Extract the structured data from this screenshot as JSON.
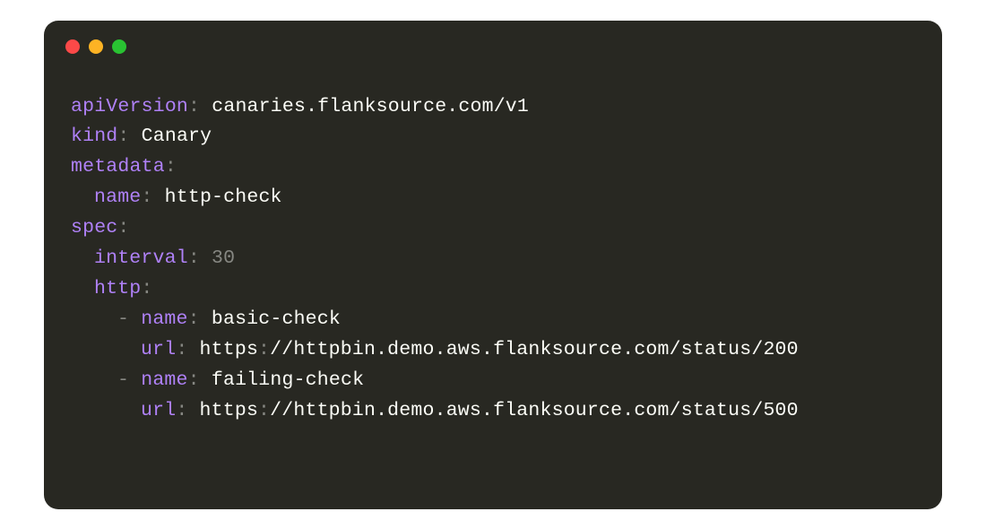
{
  "code": {
    "apiVersion_key": "apiVersion",
    "apiVersion_val": "canaries.flanksource.com/v1",
    "kind_key": "kind",
    "kind_val": "Canary",
    "metadata_key": "metadata",
    "meta_name_key": "name",
    "meta_name_val": "http-check",
    "spec_key": "spec",
    "interval_key": "interval",
    "interval_val": "30",
    "http_key": "http",
    "item1_name_key": "name",
    "item1_name_val": "basic-check",
    "item1_url_key": "url",
    "item1_url_scheme": "https",
    "item1_url_rest": "//httpbin.demo.aws.flanksource.com/status/200",
    "item2_name_key": "name",
    "item2_name_val": "failing-check",
    "item2_url_key": "url",
    "item2_url_scheme": "https",
    "item2_url_rest": "//httpbin.demo.aws.flanksource.com/status/500",
    "colon": ":",
    "dash": "-"
  }
}
